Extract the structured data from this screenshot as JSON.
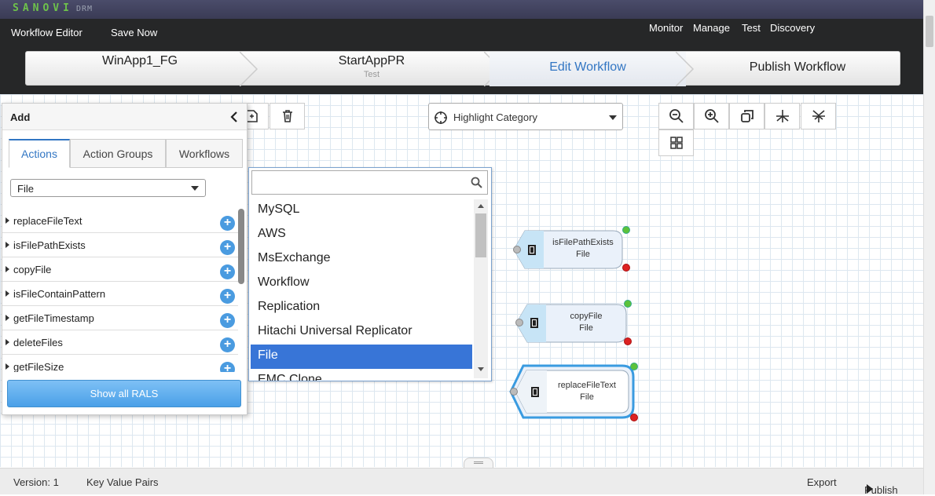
{
  "brand": {
    "logo": "SANOVI",
    "sub": "DRM",
    "accent": "#3276c3",
    "green": "#6ec24b"
  },
  "header": {
    "left_links": [
      "Workflow Editor",
      "Save Now"
    ],
    "right_links": [
      "Monitor",
      "Manage",
      "Test",
      "Discovery"
    ]
  },
  "steps": [
    {
      "label": "WinApp1_FG",
      "sub": ""
    },
    {
      "label": "StartAppPR",
      "sub": "Test"
    },
    {
      "label": "Edit Workflow",
      "sub": ""
    },
    {
      "label": "Publish Workflow",
      "sub": ""
    }
  ],
  "toolbar": {
    "icons": [
      "save-icon",
      "delete-icon"
    ],
    "zoom_icons": [
      "zoom-out-icon",
      "zoom-in-icon",
      "copy-icon",
      "fork-icon",
      "merge-icon",
      "grid-icon"
    ]
  },
  "highlight": {
    "placeholder": "Highlight Category"
  },
  "panel": {
    "title": "Add",
    "tabs": [
      "Actions",
      "Action Groups",
      "Workflows"
    ],
    "active_tab": "Actions",
    "category": "File",
    "actions": [
      "replaceFileText",
      "isFilePathExists",
      "copyFile",
      "isFileContainPattern",
      "getFileTimestamp",
      "deleteFiles",
      "getFileSize"
    ],
    "show_all": "Show all RALS"
  },
  "dropdown": {
    "search_value": "",
    "items": [
      "MySQL",
      "AWS",
      "MsExchange",
      "Workflow",
      "Replication",
      "Hitachi Universal Replicator",
      "File",
      "EMC Clone"
    ],
    "selected": "File"
  },
  "nodes": [
    {
      "name": "isFilePathExists",
      "type": "File"
    },
    {
      "name": "copyFile",
      "type": "File"
    },
    {
      "name": "replaceFileText",
      "type": "File"
    }
  ],
  "footer": {
    "version": "Version: 1",
    "kvp": "Key Value Pairs",
    "export": "Export",
    "publish": "Publish"
  }
}
